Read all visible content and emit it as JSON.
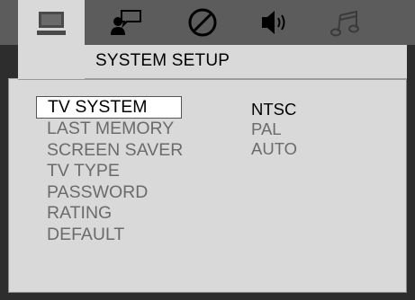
{
  "header": {
    "title": "SYSTEM SETUP"
  },
  "tabs": [
    {
      "icon": "monitor-icon",
      "active": true
    },
    {
      "icon": "person-speech-icon",
      "active": false
    },
    {
      "icon": "circle-slash-icon",
      "active": false
    },
    {
      "icon": "speaker-icon",
      "active": false
    },
    {
      "icon": "music-note-icon",
      "active": false
    }
  ],
  "menu": {
    "items": [
      {
        "label": "TV SYSTEM",
        "selected": true
      },
      {
        "label": "LAST MEMORY",
        "selected": false
      },
      {
        "label": "SCREEN SAVER",
        "selected": false
      },
      {
        "label": "TV TYPE",
        "selected": false
      },
      {
        "label": "PASSWORD",
        "selected": false
      },
      {
        "label": "RATING",
        "selected": false
      },
      {
        "label": "DEFAULT",
        "selected": false
      }
    ]
  },
  "options": {
    "items": [
      {
        "label": "NTSC",
        "current": true
      },
      {
        "label": "PAL",
        "current": false
      },
      {
        "label": "AUTO",
        "current": false
      }
    ]
  },
  "colors": {
    "background": "#2d2d2d",
    "tab_bar": "#5c5c5c",
    "panel": "#d9d9d9",
    "text_active": "#000000",
    "text_inactive": "#6b6b6b"
  }
}
